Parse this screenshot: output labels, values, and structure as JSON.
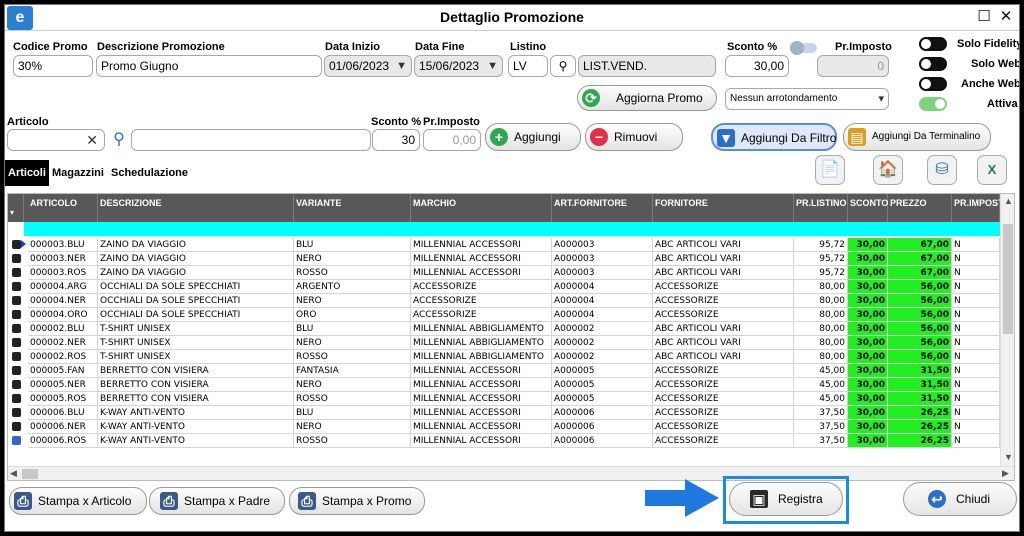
{
  "window": {
    "title": "Dettaglio Promozione",
    "app_icon": "e",
    "maximize_glyph": "☐",
    "close_glyph": "✕"
  },
  "header": {
    "codice_label": "Codice Promo",
    "codice_value": "30%",
    "descr_label": "Descrizione Promozione",
    "descr_value": "Promo Giugno",
    "inizio_label": "Data Inizio",
    "inizio_value": "01/06/2023",
    "fine_label": "Data Fine",
    "fine_value": "15/06/2023",
    "listino_label": "Listino",
    "listino_code": "LV",
    "listino_name": "LIST.VEND.",
    "sconto_label": "Sconto %",
    "sconto_value": "30,00",
    "prezzo_label": "Pr.Imposto",
    "prezzo_value": "0",
    "aggiorna_label": "Aggiorna Promo",
    "arrotondamento_value": "Nessun arrotondamento"
  },
  "toggles": [
    {
      "label": "Solo Fidelity",
      "state": "off"
    },
    {
      "label": "Solo Web",
      "state": "off"
    },
    {
      "label": "Anche Web",
      "state": "off"
    },
    {
      "label": "Attiva",
      "state": "on"
    }
  ],
  "articolo": {
    "label": "Articolo",
    "clear_glyph": "✕",
    "sconto_label": "Sconto %",
    "sconto_value": "30",
    "prezzo_label": "Pr.Imposto",
    "prezzo_value": "0,00",
    "aggiungi_label": "Aggiungi",
    "rimuovi_label": "Rimuovi",
    "filtro_label": "Aggiungi Da Filtro",
    "terminalino_label": "Aggiungi Da Terminalino"
  },
  "tabs": [
    "Articoli",
    "Magazzini",
    "Schedulazione"
  ],
  "grid": {
    "sort_glyph": "▾",
    "columns": [
      "ARTICOLO",
      "DESCRIZIONE",
      "VARIANTE",
      "MARCHIO",
      "ART.FORNITORE",
      "FORNITORE",
      "PR.LISTINO",
      "SCONTO",
      "PREZZO",
      "PR.IMPOSTO"
    ],
    "rows": [
      [
        "000003.BLU",
        "ZAINO DA VIAGGIO",
        "BLU",
        "MILLENNIAL ACCESSORI",
        "A000003",
        "ABC ARTICOLI VARI",
        "95,72",
        "30,00",
        "67,00",
        "N"
      ],
      [
        "000003.NER",
        "ZAINO DA VIAGGIO",
        "NERO",
        "MILLENNIAL ACCESSORI",
        "A000003",
        "ABC ARTICOLI VARI",
        "95,72",
        "30,00",
        "67,00",
        "N"
      ],
      [
        "000003.ROS",
        "ZAINO DA VIAGGIO",
        "ROSSO",
        "MILLENNIAL ACCESSORI",
        "A000003",
        "ABC ARTICOLI VARI",
        "95,72",
        "30,00",
        "67,00",
        "N"
      ],
      [
        "000004.ARG",
        "OCCHIALI DA SOLE SPECCHIATI",
        "ARGENTO",
        "ACCESSORIZE",
        "A000004",
        "ACCESSORIZE",
        "80,00",
        "30,00",
        "56,00",
        "N"
      ],
      [
        "000004.NER",
        "OCCHIALI DA SOLE SPECCHIATI",
        "NERO",
        "ACCESSORIZE",
        "A000004",
        "ACCESSORIZE",
        "80,00",
        "30,00",
        "56,00",
        "N"
      ],
      [
        "000004.ORO",
        "OCCHIALI DA SOLE SPECCHIATI",
        "ORO",
        "ACCESSORIZE",
        "A000004",
        "ACCESSORIZE",
        "80,00",
        "30,00",
        "56,00",
        "N"
      ],
      [
        "000002.BLU",
        "T-SHIRT UNISEX",
        "BLU",
        "MILLENNIAL ABBIGLIAMENTO",
        "A000002",
        "ABC ARTICOLI VARI",
        "80,00",
        "30,00",
        "56,00",
        "N"
      ],
      [
        "000002.NER",
        "T-SHIRT UNISEX",
        "NERO",
        "MILLENNIAL ABBIGLIAMENTO",
        "A000002",
        "ABC ARTICOLI VARI",
        "80,00",
        "30,00",
        "56,00",
        "N"
      ],
      [
        "000002.ROS",
        "T-SHIRT UNISEX",
        "ROSSO",
        "MILLENNIAL ABBIGLIAMENTO",
        "A000002",
        "ABC ARTICOLI VARI",
        "80,00",
        "30,00",
        "56,00",
        "N"
      ],
      [
        "000005.FAN",
        "BERRETTO CON VISIERA",
        "FANTASIA",
        "MILLENNIAL ACCESSORI",
        "A000005",
        "ACCESSORIZE",
        "45,00",
        "30,00",
        "31,50",
        "N"
      ],
      [
        "000005.NER",
        "BERRETTO CON VISIERA",
        "NERO",
        "MILLENNIAL ACCESSORI",
        "A000005",
        "ACCESSORIZE",
        "45,00",
        "30,00",
        "31,50",
        "N"
      ],
      [
        "000005.ROS",
        "BERRETTO CON VISIERA",
        "ROSSO",
        "MILLENNIAL ACCESSORI",
        "A000005",
        "ACCESSORIZE",
        "45,00",
        "30,00",
        "31,50",
        "N"
      ],
      [
        "000006.BLU",
        "K-WAY ANTI-VENTO",
        "BLU",
        "MILLENNIAL ACCESSORI",
        "A000006",
        "ACCESSORIZE",
        "37,50",
        "30,00",
        "26,25",
        "N"
      ],
      [
        "000006.NER",
        "K-WAY ANTI-VENTO",
        "NERO",
        "MILLENNIAL ACCESSORI",
        "A000006",
        "ACCESSORIZE",
        "37,50",
        "30,00",
        "26,25",
        "N"
      ],
      [
        "000006.ROS",
        "K-WAY ANTI-VENTO",
        "ROSSO",
        "MILLENNIAL ACCESSORI",
        "A000006",
        "ACCESSORIZE",
        "37,50",
        "30,00",
        "26,25",
        "N"
      ]
    ]
  },
  "footer": {
    "stampa_articolo": "Stampa x Articolo",
    "stampa_padre": "Stampa x Padre",
    "stampa_promo": "Stampa x Promo",
    "registra": "Registra",
    "chiudi": "Chiudi"
  },
  "colors": {
    "accent": "#1e78e0",
    "highlight_green": "#22ee22",
    "cyan_row": "#00ffff",
    "header_gray": "#585858"
  }
}
